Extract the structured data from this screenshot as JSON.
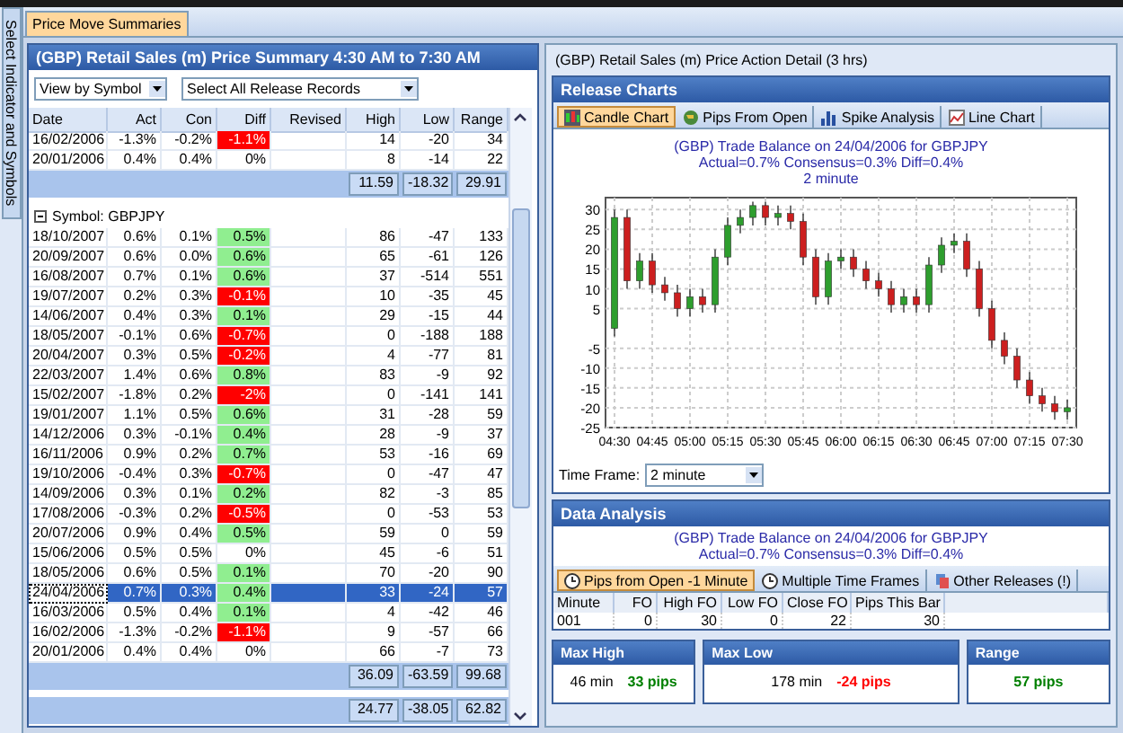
{
  "side_tab": {
    "label": "Select Indicator and Symbols"
  },
  "tabs": [
    {
      "label": "Price Move Summaries",
      "selected": true
    }
  ],
  "summary": {
    "title": "(GBP) Retail Sales (m) Price Summary 4:30 AM to 7:30 AM",
    "view_select": "View by Symbol",
    "records_select": "Select All Release Records",
    "columns": [
      "Date",
      "Act",
      "Con",
      "Diff",
      "Revised",
      "High",
      "Low",
      "Range"
    ],
    "groups": [
      {
        "rows": [
          {
            "date": "16/02/2006",
            "act": "-1.3%",
            "con": "-0.2%",
            "diff": "-1.1%",
            "high": "14",
            "low": "-20",
            "range": "34",
            "color": "#ff0000",
            "selected": false
          },
          {
            "date": "20/01/2006",
            "act": "0.4%",
            "con": "0.4%",
            "diff": "0%",
            "high": "8",
            "low": "-14",
            "range": "22",
            "color": "#ffffff",
            "selected": false
          }
        ],
        "totals": [
          "11.59",
          "-18.32",
          "29.91"
        ]
      },
      {
        "label": "Symbol: GBPJPY",
        "expanded": true,
        "rows": [
          {
            "date": "18/10/2007",
            "act": "0.6%",
            "con": "0.1%",
            "diff": "0.5%",
            "high": "86",
            "low": "-47",
            "range": "133",
            "color": "#90ee90",
            "selected": false
          },
          {
            "date": "20/09/2007",
            "act": "0.6%",
            "con": "0.0%",
            "diff": "0.6%",
            "high": "65",
            "low": "-61",
            "range": "126",
            "color": "#90ee90",
            "selected": false
          },
          {
            "date": "16/08/2007",
            "act": "0.7%",
            "con": "0.1%",
            "diff": "0.6%",
            "high": "37",
            "low": "-514",
            "range": "551",
            "color": "#90ee90",
            "selected": false
          },
          {
            "date": "19/07/2007",
            "act": "0.2%",
            "con": "0.3%",
            "diff": "-0.1%",
            "high": "10",
            "low": "-35",
            "range": "45",
            "color": "#ff0000",
            "selected": false
          },
          {
            "date": "14/06/2007",
            "act": "0.4%",
            "con": "0.3%",
            "diff": "0.1%",
            "high": "29",
            "low": "-15",
            "range": "44",
            "color": "#90ee90",
            "selected": false
          },
          {
            "date": "18/05/2007",
            "act": "-0.1%",
            "con": "0.6%",
            "diff": "-0.7%",
            "high": "0",
            "low": "-188",
            "range": "188",
            "color": "#ff0000",
            "selected": false
          },
          {
            "date": "20/04/2007",
            "act": "0.3%",
            "con": "0.5%",
            "diff": "-0.2%",
            "high": "4",
            "low": "-77",
            "range": "81",
            "color": "#ff0000",
            "selected": false
          },
          {
            "date": "22/03/2007",
            "act": "1.4%",
            "con": "0.6%",
            "diff": "0.8%",
            "high": "83",
            "low": "-9",
            "range": "92",
            "color": "#90ee90",
            "selected": false
          },
          {
            "date": "15/02/2007",
            "act": "-1.8%",
            "con": "0.2%",
            "diff": "-2%",
            "high": "0",
            "low": "-141",
            "range": "141",
            "color": "#ff0000",
            "selected": false
          },
          {
            "date": "19/01/2007",
            "act": "1.1%",
            "con": "0.5%",
            "diff": "0.6%",
            "high": "31",
            "low": "-28",
            "range": "59",
            "color": "#90ee90",
            "selected": false
          },
          {
            "date": "14/12/2006",
            "act": "0.3%",
            "con": "-0.1%",
            "diff": "0.4%",
            "high": "28",
            "low": "-9",
            "range": "37",
            "color": "#90ee90",
            "selected": false
          },
          {
            "date": "16/11/2006",
            "act": "0.9%",
            "con": "0.2%",
            "diff": "0.7%",
            "high": "53",
            "low": "-16",
            "range": "69",
            "color": "#90ee90",
            "selected": false
          },
          {
            "date": "19/10/2006",
            "act": "-0.4%",
            "con": "0.3%",
            "diff": "-0.7%",
            "high": "0",
            "low": "-47",
            "range": "47",
            "color": "#ff0000",
            "selected": false
          },
          {
            "date": "14/09/2006",
            "act": "0.3%",
            "con": "0.1%",
            "diff": "0.2%",
            "high": "82",
            "low": "-3",
            "range": "85",
            "color": "#90ee90",
            "selected": false
          },
          {
            "date": "17/08/2006",
            "act": "-0.3%",
            "con": "0.2%",
            "diff": "-0.5%",
            "high": "0",
            "low": "-53",
            "range": "53",
            "color": "#ff0000",
            "selected": false
          },
          {
            "date": "20/07/2006",
            "act": "0.9%",
            "con": "0.4%",
            "diff": "0.5%",
            "high": "59",
            "low": "0",
            "range": "59",
            "color": "#90ee90",
            "selected": false
          },
          {
            "date": "15/06/2006",
            "act": "0.5%",
            "con": "0.5%",
            "diff": "0%",
            "high": "45",
            "low": "-6",
            "range": "51",
            "color": "#ffffff",
            "selected": false
          },
          {
            "date": "18/05/2006",
            "act": "0.6%",
            "con": "0.5%",
            "diff": "0.1%",
            "high": "70",
            "low": "-20",
            "range": "90",
            "color": "#90ee90",
            "selected": false
          },
          {
            "date": "24/04/2006",
            "act": "0.7%",
            "con": "0.3%",
            "diff": "0.4%",
            "high": "33",
            "low": "-24",
            "range": "57",
            "color": "#90ee90",
            "selected": true
          },
          {
            "date": "16/03/2006",
            "act": "0.5%",
            "con": "0.4%",
            "diff": "0.1%",
            "high": "4",
            "low": "-42",
            "range": "46",
            "color": "#90ee90",
            "selected": false
          },
          {
            "date": "16/02/2006",
            "act": "-1.3%",
            "con": "-0.2%",
            "diff": "-1.1%",
            "high": "9",
            "low": "-57",
            "range": "66",
            "color": "#ff0000",
            "selected": false
          },
          {
            "date": "20/01/2006",
            "act": "0.4%",
            "con": "0.4%",
            "diff": "0%",
            "high": "66",
            "low": "-7",
            "range": "73",
            "color": "#ffffff",
            "selected": false
          }
        ],
        "totals": [
          "36.09",
          "-63.59",
          "99.68"
        ]
      }
    ],
    "grand_totals": [
      "24.77",
      "-38.05",
      "62.82"
    ]
  },
  "detail": {
    "title": "(GBP) Retail Sales (m) Price Action Detail (3 hrs)",
    "release_charts": {
      "title": "Release Charts",
      "tabs": [
        {
          "label": "Candle Chart",
          "kind": "candle",
          "selected": true
        },
        {
          "label": "Pips From Open",
          "kind": "pips",
          "selected": false
        },
        {
          "label": "Spike Analysis",
          "kind": "spike",
          "selected": false
        },
        {
          "label": "Line Chart",
          "kind": "line",
          "selected": false
        }
      ],
      "chart_title": [
        "(GBP) Trade Balance on 24/04/2006 for GBPJPY",
        "Actual=0.7% Consensus=0.3% Diff=0.4%",
        "2 minute"
      ],
      "chart_data": {
        "type": "candlestick",
        "grid": true,
        "ylim": [
          -25,
          33
        ],
        "yticks": [
          30,
          25,
          20,
          15,
          10,
          5,
          -5,
          -10,
          -15,
          -20,
          -25
        ],
        "categories": [
          "04:30",
          null,
          null,
          "04:45",
          null,
          null,
          "05:00",
          null,
          null,
          "05:15",
          null,
          null,
          "05:30",
          null,
          null,
          "05:45",
          null,
          null,
          "06:00",
          null,
          null,
          "06:15",
          null,
          null,
          "06:30",
          null,
          null,
          "06:45",
          null,
          null,
          "07:00",
          null,
          null,
          "07:15",
          null,
          null,
          "07:30"
        ],
        "ohlc": [
          [
            0,
            30,
            -2,
            28
          ],
          [
            28,
            30,
            10,
            12
          ],
          [
            12,
            19,
            10,
            17
          ],
          [
            17,
            19,
            9,
            11
          ],
          [
            11,
            13,
            7,
            9
          ],
          [
            9,
            11,
            3,
            5
          ],
          [
            5,
            10,
            3,
            8
          ],
          [
            8,
            10,
            4,
            6
          ],
          [
            6,
            20,
            4,
            18
          ],
          [
            18,
            28,
            16,
            26
          ],
          [
            26,
            30,
            24,
            28
          ],
          [
            28,
            32,
            26,
            31
          ],
          [
            31,
            32,
            26,
            28
          ],
          [
            28,
            31,
            26,
            29
          ],
          [
            29,
            31,
            25,
            27
          ],
          [
            27,
            29,
            16,
            18
          ],
          [
            18,
            20,
            6,
            8
          ],
          [
            8,
            19,
            6,
            17
          ],
          [
            17,
            20,
            15,
            18
          ],
          [
            18,
            20,
            13,
            15
          ],
          [
            15,
            17,
            10,
            12
          ],
          [
            12,
            14,
            8,
            10
          ],
          [
            10,
            12,
            4,
            6
          ],
          [
            6,
            10,
            4,
            8
          ],
          [
            8,
            10,
            4,
            6
          ],
          [
            6,
            18,
            4,
            16
          ],
          [
            16,
            23,
            14,
            21
          ],
          [
            21,
            24,
            19,
            22
          ],
          [
            22,
            24,
            13,
            15
          ],
          [
            15,
            17,
            3,
            5
          ],
          [
            5,
            7,
            -5,
            -3
          ],
          [
            -3,
            -1,
            -9,
            -7
          ],
          [
            -7,
            -5,
            -15,
            -13
          ],
          [
            -13,
            -11,
            -19,
            -17
          ],
          [
            -17,
            -15,
            -21,
            -19
          ],
          [
            -19,
            -17,
            -23,
            -21
          ],
          [
            -21,
            -18,
            -23,
            -20
          ]
        ]
      },
      "time_frame": {
        "label": "Time Frame:",
        "value": "2 minute"
      }
    },
    "data_analysis": {
      "title": "Data Analysis",
      "subtitle": [
        "(GBP) Trade Balance on 24/04/2006 for GBPJPY",
        "Actual=0.7% Consensus=0.3% Diff=0.4%"
      ],
      "tabs": [
        {
          "label": "Pips from Open -1 Minute",
          "kind": "clock",
          "selected": true
        },
        {
          "label": "Multiple Time Frames",
          "kind": "clock",
          "selected": false
        },
        {
          "label": "Other Releases (!)",
          "kind": "pages",
          "selected": false
        }
      ],
      "columns": [
        "Minute",
        "FO",
        "High FO",
        "Low FO",
        "Close FO",
        "Pips This Bar"
      ],
      "rows": [
        [
          "001",
          "0",
          "30",
          "0",
          "22",
          "30"
        ]
      ]
    },
    "stats": [
      {
        "title": "Max High",
        "minutes": "46 min",
        "pips": "33 pips",
        "color": "#008000"
      },
      {
        "title": "Max Low",
        "minutes": "178 min",
        "pips": "-24 pips",
        "color": "#ff0000"
      },
      {
        "title": "Range",
        "pips": "57 pips",
        "color": "#008000"
      }
    ]
  }
}
